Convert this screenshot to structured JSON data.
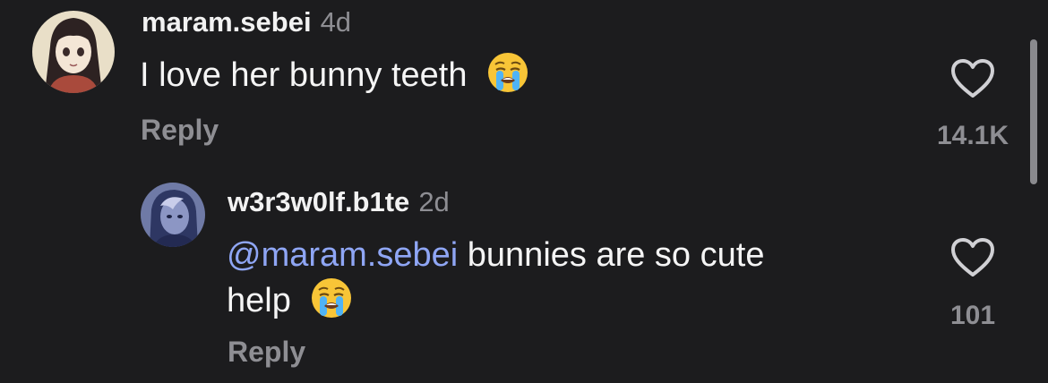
{
  "comments": [
    {
      "username": "maram.sebei",
      "time": "4d",
      "text": "I love her bunny teeth",
      "reply_label": "Reply",
      "like_count": "14.1K",
      "avatar_icon": "anime-girl-avatar",
      "emoji_icon": "loudly-crying-face-icon"
    },
    {
      "username": "w3r3w0lf.b1te",
      "time": "2d",
      "mention": "@maram.sebei",
      "text_line1": "bunnies are so cute",
      "text_line2": "help",
      "reply_label": "Reply",
      "like_count": "101",
      "avatar_icon": "character-avatar",
      "emoji_icon": "loudly-crying-face-icon"
    }
  ],
  "colors": {
    "background": "#1c1c1e",
    "text": "#f5f5f5",
    "secondary": "#8e8e93",
    "mention": "#8fa6f5"
  }
}
